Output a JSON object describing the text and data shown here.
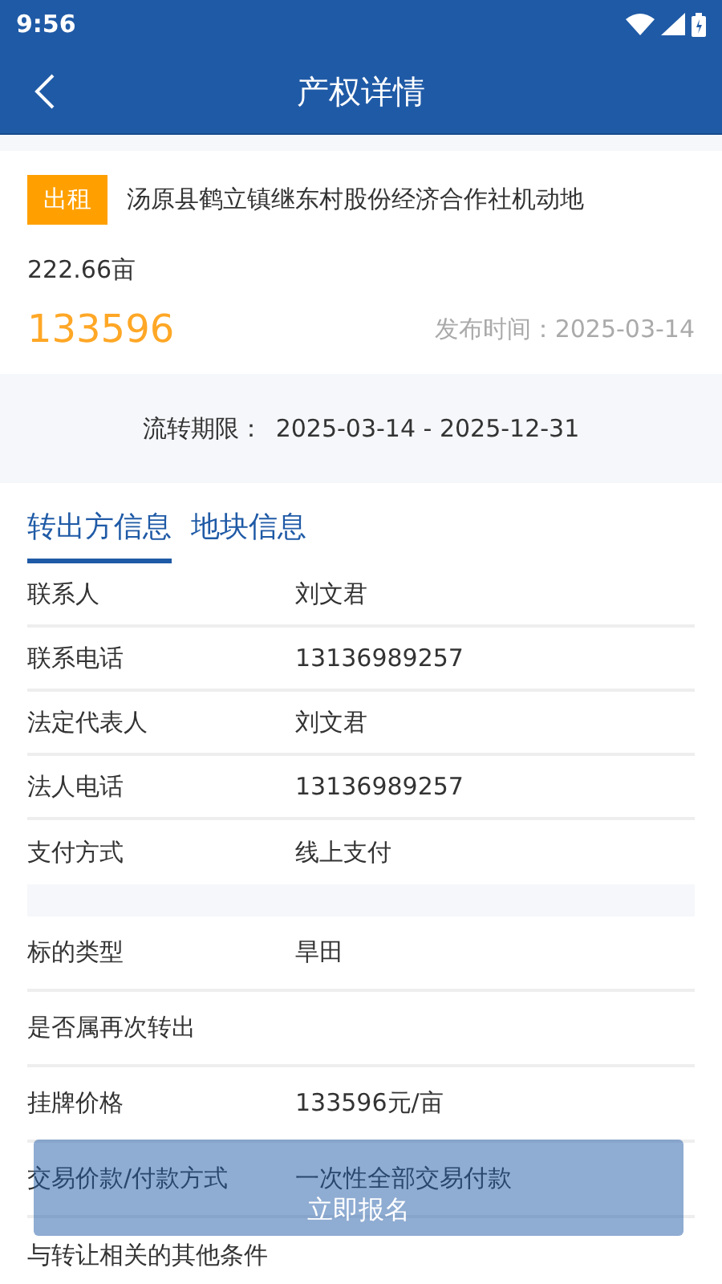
{
  "status_bar": {
    "time": "9:56"
  },
  "header": {
    "title": "产权详情"
  },
  "listing": {
    "tag": "出租",
    "title": "汤原县鹤立镇继东村股份经济合作社机动地",
    "area": "222.66亩",
    "price": "133596",
    "publish_label": "发布时间：",
    "publish_date": "2025-03-14"
  },
  "period": {
    "label": "流转期限：",
    "value": "2025-03-14 - 2025-12-31"
  },
  "tabs": [
    {
      "label": "转出方信息",
      "selected": true
    },
    {
      "label": "地块信息",
      "selected": false
    }
  ],
  "sections": [
    {
      "rows": [
        {
          "label": "联系人",
          "value": "刘文君"
        },
        {
          "label": "联系电话",
          "value": "13136989257"
        },
        {
          "label": "法定代表人",
          "value": "刘文君"
        },
        {
          "label": "法人电话",
          "value": "13136989257"
        },
        {
          "label": "支付方式",
          "value": "线上支付"
        }
      ]
    },
    {
      "rows": [
        {
          "label": "标的类型",
          "value": "旱田"
        },
        {
          "label": "是否属再次转出"
        },
        {
          "label": "挂牌价格",
          "value": "133596元/亩"
        },
        {
          "label": "交易价款/付款方式",
          "value": "一次性全部交易付款"
        },
        {
          "label": "与转让相关的其他条件"
        }
      ]
    }
  ],
  "action_button": {
    "label": "立即报名"
  }
}
